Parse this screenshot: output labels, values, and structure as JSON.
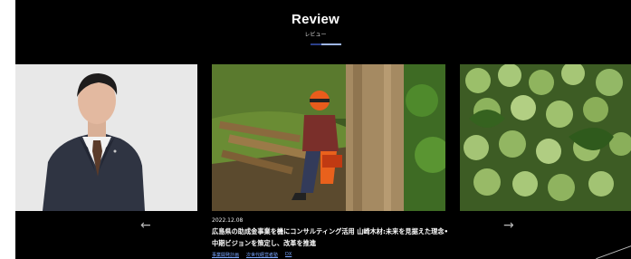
{
  "section": {
    "title": "Review",
    "subtitle": "レビュー"
  },
  "nav": {
    "prev": "←",
    "next": "→"
  },
  "featured": {
    "date": "2022.12.08",
    "headline": "広島県の助成金事業を機にコンサルティング活用 山崎木材:未来を見据えた理念•中期ビジョンを策定し、改革を推進",
    "tags": [
      "事業開発計画",
      "次世代経営者塾",
      "DX"
    ]
  },
  "colors": {
    "background": "#000000",
    "tag_link": "#7aa6ff",
    "indicator_active": "#9fb6e6",
    "indicator_dark": "#2b3f8a"
  },
  "icons": [
    "arrow-left-icon",
    "arrow-right-icon"
  ]
}
